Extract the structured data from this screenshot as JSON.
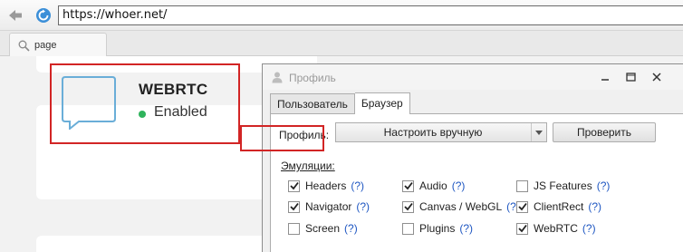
{
  "browser": {
    "url": "https://whoer.net/",
    "tab_label": "page"
  },
  "card": {
    "title": "WEBRTC",
    "status": "Enabled",
    "status_color": "#2fb35c"
  },
  "dialog": {
    "title": "Профиль",
    "tabs": [
      {
        "label": "Пользователь",
        "active": false
      },
      {
        "label": "Браузер",
        "active": true
      }
    ],
    "profile_label": "Профиль:",
    "profile_value": "Настроить вручную",
    "check_button": "Проверить",
    "emulations_label": "Эмуляции:",
    "help_text": "(?)",
    "options": [
      {
        "label": "Headers",
        "checked": true
      },
      {
        "label": "Audio",
        "checked": true
      },
      {
        "label": "JS Features",
        "checked": false
      },
      {
        "label": "Navigator",
        "checked": true
      },
      {
        "label": "Canvas / WebGL",
        "checked": true
      },
      {
        "label": "ClientRect",
        "checked": true
      },
      {
        "label": "Screen",
        "checked": false
      },
      {
        "label": "Plugins",
        "checked": false
      },
      {
        "label": "WebRTC",
        "checked": true
      }
    ]
  },
  "colors": {
    "highlight": "#d22525",
    "help_link": "#1f57c2"
  }
}
